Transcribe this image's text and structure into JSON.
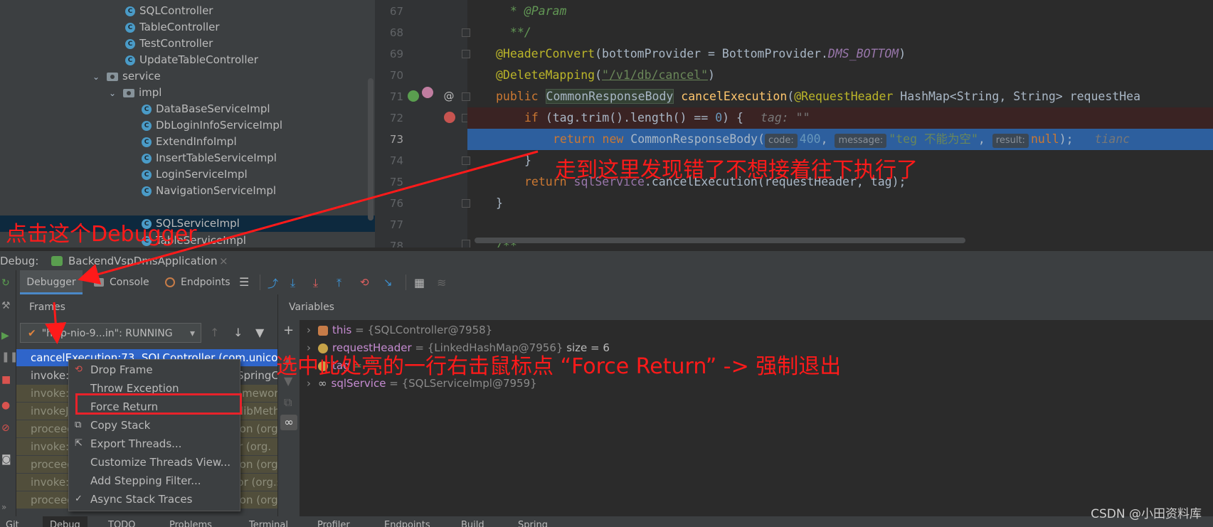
{
  "tree": {
    "items": [
      {
        "label": "SQLController",
        "icon": "class-icon"
      },
      {
        "label": "TableController",
        "icon": "class-icon"
      },
      {
        "label": "TestController",
        "icon": "class-icon"
      },
      {
        "label": "UpdateTableController",
        "icon": "class-icon"
      },
      {
        "label": "service",
        "icon": "package-icon"
      },
      {
        "label": "impl",
        "icon": "package-icon"
      },
      {
        "label": "DataBaseServiceImpl",
        "icon": "class-icon"
      },
      {
        "label": "DbLoginInfoServiceImpl",
        "icon": "class-icon"
      },
      {
        "label": "ExtendInfoImpl",
        "icon": "class-icon"
      },
      {
        "label": "InsertTableServiceImpl",
        "icon": "class-icon"
      },
      {
        "label": "LoginServiceImpl",
        "icon": "class-icon"
      },
      {
        "label": "NavigationServiceImpl",
        "icon": "class-icon"
      },
      {
        "label": "SQLServiceImpl",
        "icon": "class-icon",
        "selected": true
      },
      {
        "label": "TableServiceImpl",
        "icon": "class-icon"
      }
    ]
  },
  "editor": {
    "line_numbers": [
      "67",
      "68",
      "69",
      "70",
      "71",
      "72",
      "73",
      "74",
      "75",
      "76",
      "77",
      "78"
    ],
    "current_line": "73",
    "l67": {
      "text": " * @Param"
    },
    "l68": {
      "text": " **/"
    },
    "l69": {
      "ann": "@HeaderConvert",
      "rest1": "(bottomProvider = BottomProvider.",
      "field": "DMS_BOTTOM",
      "rest2": ")"
    },
    "l70": {
      "ann": "@DeleteMapping",
      "rest1": "(",
      "str": "\"/v1/db/cancel\"",
      "rest2": ")"
    },
    "l71": {
      "kw": "public ",
      "type": "CommonResponseBody",
      "fn": " cancelExecution",
      "rest1": "(",
      "ann": "@RequestHeader",
      "rest2": " HashMap<String, String> requestHea"
    },
    "l72": {
      "kw": "if ",
      "rest1": "(tag.trim().length() == ",
      "num": "0",
      "rest2": ") {",
      "hint": "tag: \"\""
    },
    "l73": {
      "kw1": "return ",
      "kw2": "new ",
      "rest1": "CommonResponseBody(",
      "p1": "code:",
      "v1": "400",
      "p2": "message:",
      "v2": "\"teg 不能为空\"",
      "p3": "result:",
      "v3": "null",
      "rest2": ");",
      "hint": "tianc"
    },
    "l74": {
      "text": "}"
    },
    "l75": {
      "kw": "return ",
      "fld": "sqlService",
      "rest": ".cancelExecution(requestHeader, tag);"
    },
    "l76": {
      "text": "}"
    },
    "l78": {
      "text": "/**"
    }
  },
  "debug": {
    "label": "Debug:",
    "run_config": "BackendVspDmsApplication",
    "tabs": {
      "debugger": "Debugger",
      "console": "Console",
      "endpoints": "Endpoints"
    },
    "frames_title": "Frames",
    "thread": "\"http-nio-9...in\": RUNNING",
    "frames": [
      {
        "text": "cancelExecution:73, SQLController (com.unicom",
        "kind": "sel"
      },
      {
        "text": "invoke:-1, SQLController$$FastClassBySpringCG",
        "kind": "norm"
      },
      {
        "text": "invoke:218, MethodProxy (org.springframework",
        "kind": "lib"
      },
      {
        "text": "invokeJoinpoint:783, CglibAopProxy$CglibMeth",
        "kind": "lib"
      },
      {
        "text": "proceed:163, ReflectiveMethodInvocation (org.",
        "kind": "lib"
      },
      {
        "text": "invoke:97, ExposeInvocationInterceptor (org.",
        "kind": "lib"
      },
      {
        "text": "proceed:186, ReflectiveMethodInvocation (org.",
        "kind": "lib"
      },
      {
        "text": "invoke:123, MethodValidationInterceptor (org.sp",
        "kind": "lib"
      },
      {
        "text": "proceed:186, ReflectiveMethodInvocation (org.",
        "kind": "lib"
      }
    ],
    "variables_title": "Variables",
    "variables": [
      {
        "name": "this",
        "value": "= {SQLController@7958}",
        "extra": ""
      },
      {
        "name": "requestHeader",
        "value": "= {LinkedHashMap@7956}",
        "extra": "size = 6"
      },
      {
        "name": "tag",
        "value": "= \"\"",
        "extra": ""
      },
      {
        "name": "sqlService",
        "value": "= {SQLServiceImpl@7959}",
        "extra": ""
      }
    ]
  },
  "context_menu": {
    "items": [
      {
        "label": "Drop Frame",
        "icon": "drop-frame-icon"
      },
      {
        "label": "Throw Exception",
        "icon": ""
      },
      {
        "label": "Force Return",
        "icon": ""
      },
      {
        "label": "Copy Stack",
        "icon": "copy-icon"
      },
      {
        "label": "Export Threads...",
        "icon": "export-icon"
      },
      {
        "label": "Customize Threads View...",
        "icon": ""
      },
      {
        "label": "Add Stepping Filter...",
        "icon": ""
      },
      {
        "label": "Async Stack Traces",
        "icon": "check-icon"
      }
    ]
  },
  "status_bar": {
    "tabs": [
      "Git",
      "Debug",
      "TODO",
      "Problems",
      "Terminal",
      "Profiler",
      "Endpoints",
      "Build",
      "Spring"
    ],
    "active": "Debug"
  },
  "annotations": {
    "editor_note": "走到这里发现错了不想接着往下执行了",
    "debugger_note": "点击这个Debugger",
    "force_return_note": "选中此处亮的一行右击鼠标点 “Force Return” -> 强制退出",
    "watermark": "CSDN @小田资料库"
  },
  "colors": {
    "annotation_red": "#ff1a1a",
    "selection_blue": "#2f65ca",
    "current_line_blue": "#2d5f9e",
    "breakpoint_red": "#c75450"
  }
}
